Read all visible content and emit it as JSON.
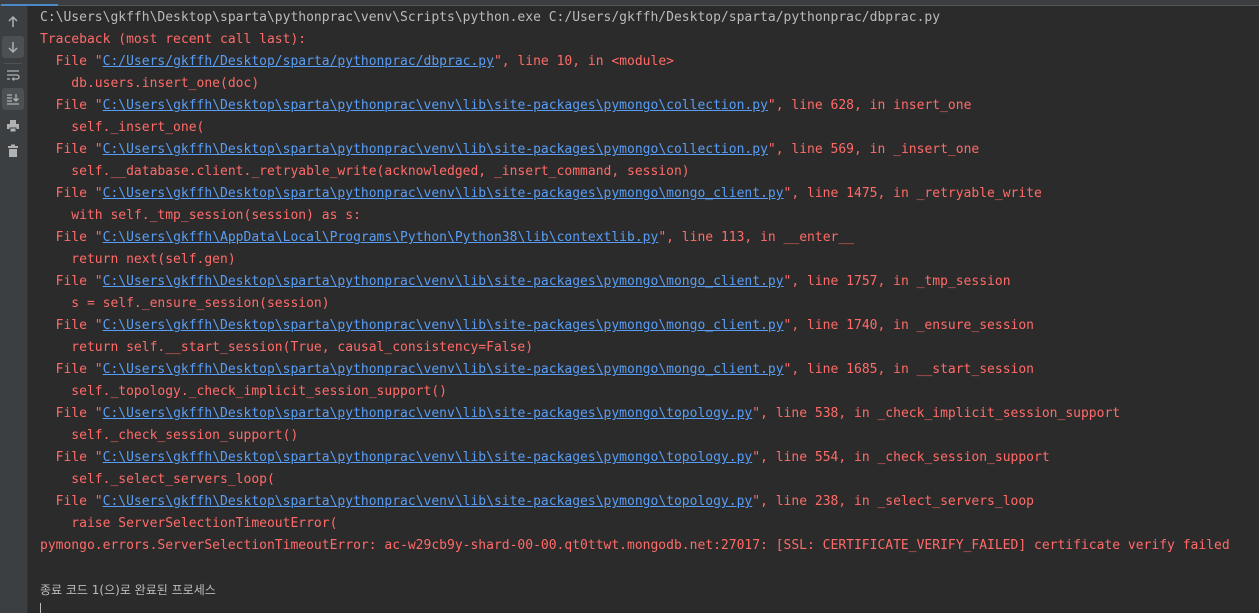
{
  "toolbar": {
    "buttons": [
      {
        "icon": "arrow-up-icon",
        "title": "Up the stack trace"
      },
      {
        "icon": "arrow-down-icon",
        "title": "Down the stack trace"
      },
      {
        "icon": "soft-wrap-icon",
        "title": "Soft-wrap"
      },
      {
        "icon": "scroll-to-end-icon",
        "title": "Scroll to the end"
      },
      {
        "icon": "print-icon",
        "title": "Print"
      },
      {
        "icon": "trash-icon",
        "title": "Clear all"
      }
    ]
  },
  "console": {
    "command": "C:\\Users\\gkffh\\Desktop\\sparta\\pythonprac\\venv\\Scripts\\python.exe C:/Users/gkffh/Desktop/sparta/pythonprac/dbprac.py",
    "traceback_header": "Traceback (most recent call last):",
    "frames": [
      {
        "prefix": "  File \"",
        "path": "C:/Users/gkffh/Desktop/sparta/pythonprac/dbprac.py",
        "suffix": "\", line 10, in <module>",
        "code": "    db.users.insert_one(doc)"
      },
      {
        "prefix": "  File \"",
        "path": "C:\\Users\\gkffh\\Desktop\\sparta\\pythonprac\\venv\\lib\\site-packages\\pymongo\\collection.py",
        "suffix": "\", line 628, in insert_one",
        "code": "    self._insert_one("
      },
      {
        "prefix": "  File \"",
        "path": "C:\\Users\\gkffh\\Desktop\\sparta\\pythonprac\\venv\\lib\\site-packages\\pymongo\\collection.py",
        "suffix": "\", line 569, in _insert_one",
        "code": "    self.__database.client._retryable_write(acknowledged, _insert_command, session)"
      },
      {
        "prefix": "  File \"",
        "path": "C:\\Users\\gkffh\\Desktop\\sparta\\pythonprac\\venv\\lib\\site-packages\\pymongo\\mongo_client.py",
        "suffix": "\", line 1475, in _retryable_write",
        "code": "    with self._tmp_session(session) as s:"
      },
      {
        "prefix": "  File \"",
        "path": "C:\\Users\\gkffh\\AppData\\Local\\Programs\\Python\\Python38\\lib\\contextlib.py",
        "suffix": "\", line 113, in __enter__",
        "code": "    return next(self.gen)"
      },
      {
        "prefix": "  File \"",
        "path": "C:\\Users\\gkffh\\Desktop\\sparta\\pythonprac\\venv\\lib\\site-packages\\pymongo\\mongo_client.py",
        "suffix": "\", line 1757, in _tmp_session",
        "code": "    s = self._ensure_session(session)"
      },
      {
        "prefix": "  File \"",
        "path": "C:\\Users\\gkffh\\Desktop\\sparta\\pythonprac\\venv\\lib\\site-packages\\pymongo\\mongo_client.py",
        "suffix": "\", line 1740, in _ensure_session",
        "code": "    return self.__start_session(True, causal_consistency=False)"
      },
      {
        "prefix": "  File \"",
        "path": "C:\\Users\\gkffh\\Desktop\\sparta\\pythonprac\\venv\\lib\\site-packages\\pymongo\\mongo_client.py",
        "suffix": "\", line 1685, in __start_session",
        "code": "    self._topology._check_implicit_session_support()"
      },
      {
        "prefix": "  File \"",
        "path": "C:\\Users\\gkffh\\Desktop\\sparta\\pythonprac\\venv\\lib\\site-packages\\pymongo\\topology.py",
        "suffix": "\", line 538, in _check_implicit_session_support",
        "code": "    self._check_session_support()"
      },
      {
        "prefix": "  File \"",
        "path": "C:\\Users\\gkffh\\Desktop\\sparta\\pythonprac\\venv\\lib\\site-packages\\pymongo\\topology.py",
        "suffix": "\", line 554, in _check_session_support",
        "code": "    self._select_servers_loop("
      },
      {
        "prefix": "  File \"",
        "path": "C:\\Users\\gkffh\\Desktop\\sparta\\pythonprac\\venv\\lib\\site-packages\\pymongo\\topology.py",
        "suffix": "\", line 238, in _select_servers_loop",
        "code": "    raise ServerSelectionTimeoutError("
      }
    ],
    "error": "pymongo.errors.ServerSelectionTimeoutError: ac-w29cb9y-shard-00-00.qt0ttwt.mongodb.net:27017: [SSL: CERTIFICATE_VERIFY_FAILED] certificate verify failed",
    "exit_message": "종료 코드 1(으)로 완료된 프로세스"
  },
  "colors": {
    "background": "#2b2b2b",
    "toolbar": "#3c3f41",
    "error_text": "#ff6b68",
    "normal_text": "#bbbbbb",
    "link": "#589df6"
  }
}
